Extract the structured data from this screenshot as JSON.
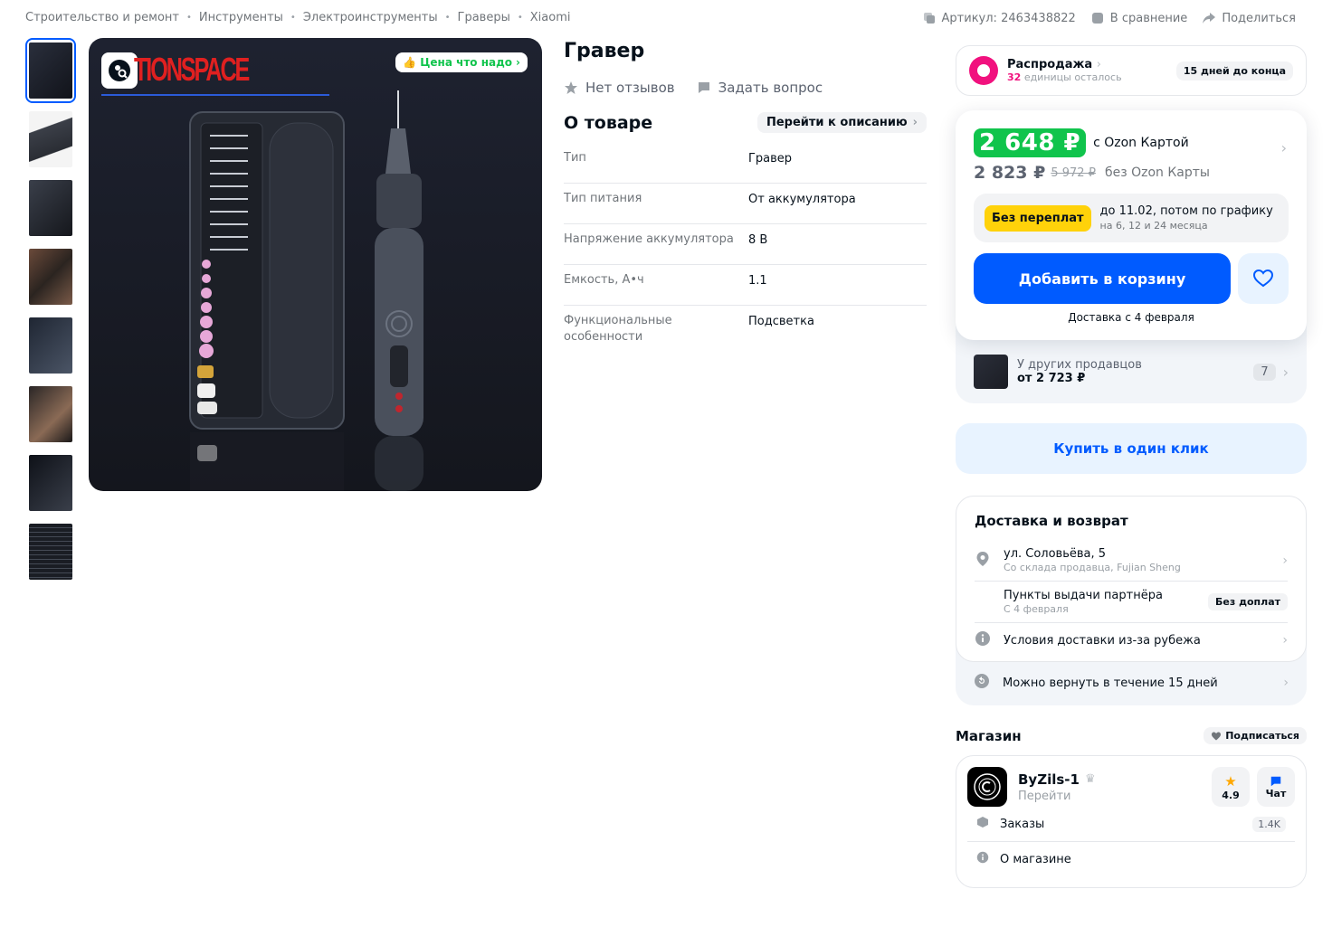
{
  "breadcrumb": [
    "Строительство и ремонт",
    "Инструменты",
    "Электроинструменты",
    "Граверы",
    "Xiaomi"
  ],
  "top_actions": {
    "article": "Артикул: 2463438822",
    "compare": "В сравнение",
    "share": "Поделиться"
  },
  "gallery": {
    "thumbnail_count": 8,
    "badge": "Цена что надо",
    "brand_text": "TIONSPACE"
  },
  "product": {
    "title": "Гравер",
    "reviews": "Нет отзывов",
    "ask": "Задать вопрос",
    "about_title": "О товаре",
    "goto_desc": "Перейти к описанию",
    "specs": [
      {
        "key": "Тип",
        "value": "Гравер"
      },
      {
        "key": "Тип питания",
        "value": "От аккумулятора"
      },
      {
        "key": "Напряжение аккумулятора",
        "value": "8 В"
      },
      {
        "key": "Емкость, А•ч",
        "value": "1.1"
      },
      {
        "key": "Функциональные особенности",
        "value": "Подсветка"
      }
    ]
  },
  "sale": {
    "title": "Распродажа",
    "count": "32",
    "remaining": "единицы осталось",
    "days_left": "15 дней до конца"
  },
  "price": {
    "card_price": "2 648 ₽",
    "card_label": "с Ozon Картой",
    "regular_price": "2 823 ₽",
    "old_price": "5 972 ₽",
    "regular_label": "без Ozon Карты",
    "installment_badge": "Без переплат",
    "installment_text": "до 11.02, потом по графику",
    "installment_sub": "на 6, 12 и 24 месяца",
    "add_to_cart": "Добавить в корзину",
    "delivery_note": "Доставка с 4 февраля"
  },
  "other_sellers": {
    "label": "У других продавцов",
    "from": "от 2 723 ₽",
    "count": "7"
  },
  "one_click": "Купить в один клик",
  "delivery": {
    "title": "Доставка и возврат",
    "address": "ул. Соловьёва, 5",
    "address_sub": "Со склада продавца, Fujian Sheng",
    "pickup": "Пункты выдачи партнёра",
    "pickup_sub": "С 4 февраля",
    "pickup_badge": "Без доплат",
    "abroad": "Условия доставки из-за рубежа",
    "return": "Можно вернуть в течение 15 дней"
  },
  "shop": {
    "label": "Магазин",
    "subscribe": "Подписаться",
    "name": "ByZils-1",
    "go": "Перейти",
    "rating": "4.9",
    "chat": "Чат",
    "orders": "Заказы",
    "orders_count": "1.4K",
    "about": "О магазине"
  },
  "colors": {
    "accent": "#005bff",
    "price_green": "#10c44c",
    "sale_pink": "#f1117e",
    "installment_yellow": "#ffd20a"
  }
}
